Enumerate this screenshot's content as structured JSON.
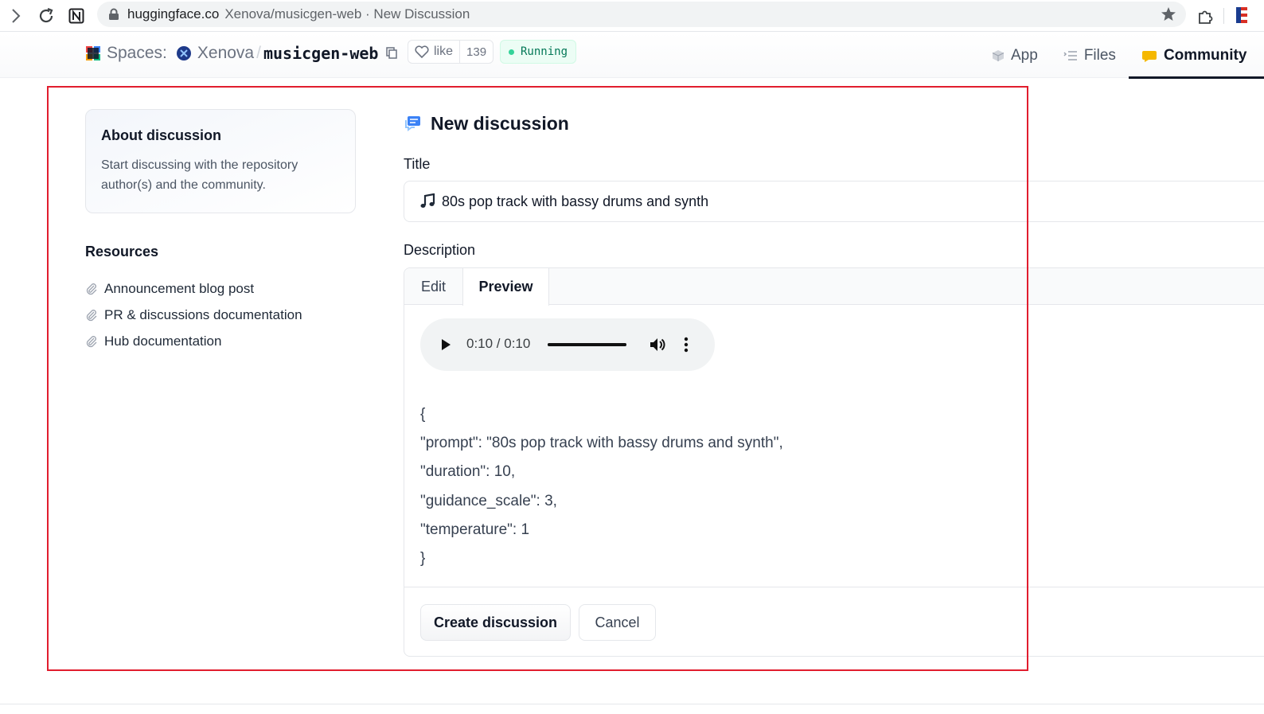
{
  "browser": {
    "url_host": "huggingface.co",
    "url_path": "Xenova/musicgen-web · New Discussion"
  },
  "header": {
    "spaces_label": "Spaces:",
    "owner": "Xenova",
    "separator": "/",
    "repo": "musicgen-web",
    "like_label": "like",
    "like_count": "139",
    "status": "Running",
    "tabs": [
      {
        "label": "App",
        "icon": "app-cube-icon",
        "active": false
      },
      {
        "label": "Files",
        "icon": "files-icon",
        "active": false
      },
      {
        "label": "Community",
        "icon": "community-icon",
        "active": true
      }
    ]
  },
  "sidebar": {
    "about_title": "About discussion",
    "about_text": "Start discussing with the repository author(s) and the community.",
    "resources_title": "Resources",
    "resources": [
      {
        "label": "Announcement blog post",
        "icon": "paperclip-icon"
      },
      {
        "label": "PR & discussions documentation",
        "icon": "paperclip-icon"
      },
      {
        "label": "Hub documentation",
        "icon": "paperclip-icon"
      }
    ]
  },
  "form": {
    "heading": "New discussion",
    "title_label": "Title",
    "title_value": "80s pop track with bassy drums and synth",
    "description_label": "Description",
    "tabs": [
      {
        "label": "Edit",
        "active": false
      },
      {
        "label": "Preview",
        "active": true
      }
    ],
    "audio": {
      "time": "0:10 / 0:10",
      "progress": 1.0
    },
    "json_lines": [
      "{",
      "\"prompt\": \"80s pop track with bassy drums and synth\",",
      "\"duration\": 10,",
      "\"guidance_scale\": 3,",
      "\"temperature\": 1",
      "}"
    ],
    "create_label": "Create discussion",
    "cancel_label": "Cancel"
  },
  "colors": {
    "annotation": "#e11d2e",
    "status_green": "#047857",
    "community_icon": "#f5b800",
    "discussion_icon": "#3b82f6"
  }
}
